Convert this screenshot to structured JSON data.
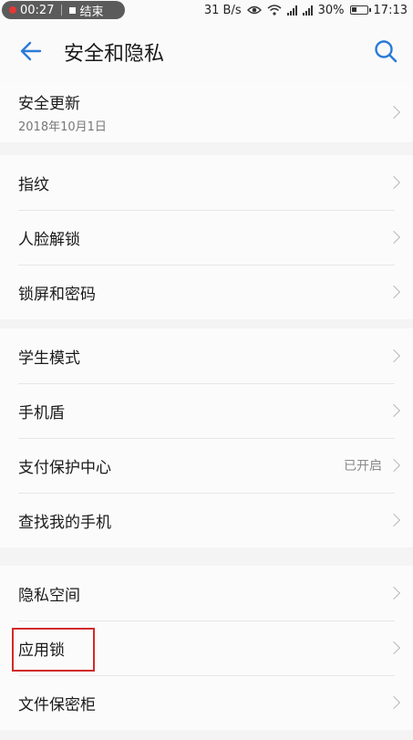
{
  "status_bar": {
    "rec_time": "00:27",
    "end_label": "结束",
    "network_speed": "31 B/s",
    "battery": "30%",
    "clock": "17:13"
  },
  "header": {
    "title": "安全和隐私"
  },
  "groups": [
    {
      "items": [
        {
          "label": "安全更新",
          "sub": "2018年10月1日"
        }
      ]
    },
    {
      "items": [
        {
          "label": "指纹"
        },
        {
          "label": "人脸解锁"
        },
        {
          "label": "锁屏和密码"
        }
      ]
    },
    {
      "items": [
        {
          "label": "学生模式"
        },
        {
          "label": "手机盾"
        },
        {
          "label": "支付保护中心",
          "value": "已开启"
        },
        {
          "label": "查找我的手机"
        }
      ]
    },
    {
      "items": [
        {
          "label": "隐私空间"
        },
        {
          "label": "应用锁"
        },
        {
          "label": "文件保密柜"
        }
      ]
    }
  ],
  "colors": {
    "accent": "#2a7bd8",
    "highlight": "#d22b2b"
  }
}
